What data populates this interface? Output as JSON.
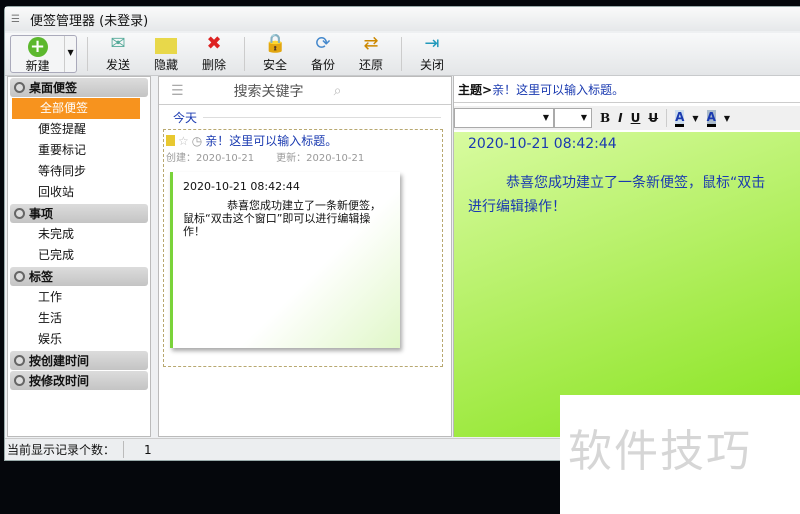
{
  "window": {
    "title": "便签管理器 (未登录)"
  },
  "toolbar": {
    "new": "新建",
    "send": "发送",
    "hide": "隐藏",
    "delete": "删除",
    "security": "安全",
    "backup": "备份",
    "restore": "还原",
    "close": "关闭"
  },
  "sidebar": {
    "sections": [
      {
        "label": "桌面便签",
        "items": [
          "全部便签",
          "便签提醒",
          "重要标记",
          "等待同步",
          "回收站"
        ]
      },
      {
        "label": "事项",
        "items": [
          "未完成",
          "已完成"
        ]
      },
      {
        "label": "标签",
        "items": [
          "工作",
          "生活",
          "娱乐"
        ]
      },
      {
        "label": "按创建时间",
        "items": []
      },
      {
        "label": "按修改时间",
        "items": []
      }
    ],
    "selected": "全部便签"
  },
  "list": {
    "search_placeholder": "搜索关键字",
    "group": "今天",
    "note": {
      "title": "亲！这里可以输入标题。",
      "created_label": "创建：",
      "created": "2020-10-21",
      "updated_label": "更新：",
      "updated": "2020-10-21",
      "timestamp": "2020-10-21 08:42:44",
      "body": "恭喜您成功建立了一条新便签，鼠标“双击这个窗口”即可以进行编辑操作！"
    }
  },
  "editor": {
    "subject_label": "主题>",
    "subject": "亲！这里可以输入标题。",
    "timestamp": "2020-10-21 08:42:44",
    "body_line1": "恭喜您成功建立了一条新便签，鼠标“双击",
    "body_line2": "进行编辑操作！",
    "format": {
      "bold": "B",
      "italic": "I",
      "underline": "U",
      "strike": "U",
      "font_color": "A",
      "highlight": "A"
    }
  },
  "status": {
    "label": "当前显示记录个数：",
    "count": "1"
  },
  "watermark": "软件技巧",
  "colors": {
    "accent": "#f7931e",
    "note_bg": "#a8ec50",
    "text_blue": "#1a3ab0"
  }
}
